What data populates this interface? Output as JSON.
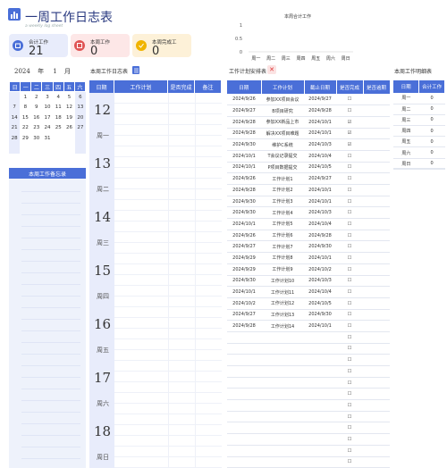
{
  "header": {
    "title": "一周工作日志表",
    "subtitle": "a weekly log sheet"
  },
  "cards": [
    {
      "label": "合计工作",
      "value": "21",
      "color": "#e8ecfb",
      "icon_color": "#4a6fd8"
    },
    {
      "label": "本周工作",
      "value": "0",
      "color": "#fde7e7",
      "icon_color": "#e05555"
    },
    {
      "label": "本周完成工",
      "value": "0",
      "color": "#fdf1d8",
      "icon_color": "#f0b400"
    }
  ],
  "chart_data": {
    "type": "bar",
    "title": "本周合计工作",
    "categories": [
      "周一",
      "周二",
      "周三",
      "周四",
      "周五",
      "周六",
      "周日"
    ],
    "values": [
      0,
      0,
      0,
      0,
      0,
      0,
      0
    ],
    "yticks": [
      "1",
      "0.5",
      "0"
    ],
    "ylim": [
      0,
      1
    ]
  },
  "calendar": {
    "year": "2024",
    "year_suffix": "年",
    "month": "1",
    "month_suffix": "月",
    "weekdays": [
      "日",
      "一",
      "二",
      "三",
      "四",
      "五",
      "六"
    ],
    "weeks": [
      [
        "",
        "1",
        "2",
        "3",
        "4",
        "5",
        "6"
      ],
      [
        "7",
        "8",
        "9",
        "10",
        "11",
        "12",
        "13"
      ],
      [
        "14",
        "15",
        "16",
        "17",
        "18",
        "19",
        "20"
      ],
      [
        "21",
        "22",
        "23",
        "24",
        "25",
        "26",
        "27"
      ],
      [
        "28",
        "29",
        "30",
        "31",
        "",
        "",
        ""
      ],
      [
        "",
        "",
        "",
        "",
        "",
        "",
        ""
      ]
    ]
  },
  "memo": {
    "title": "本周工作备忘录"
  },
  "daily": {
    "title": "本周工作日志表",
    "headers": [
      "日期",
      "工作计划",
      "是否完成",
      "备注"
    ],
    "days": [
      {
        "num": "12",
        "week": "周一"
      },
      {
        "num": "13",
        "week": "周二"
      },
      {
        "num": "14",
        "week": "周三"
      },
      {
        "num": "15",
        "week": "周四"
      },
      {
        "num": "16",
        "week": "周五"
      },
      {
        "num": "17",
        "week": "周六"
      },
      {
        "num": "18",
        "week": "周日"
      }
    ]
  },
  "schedule": {
    "title": "工作计划安排表",
    "headers": [
      "日期",
      "工作计划",
      "截止日期",
      "是否完成",
      "是否逾期"
    ],
    "rows": [
      [
        "2024/9/26",
        "参加XX项目会议",
        "2024/9/27",
        "☐",
        ""
      ],
      [
        "2024/9/27",
        "B项目研究",
        "2024/9/28",
        "☐",
        ""
      ],
      [
        "2024/9/28",
        "参加XX新品上市",
        "2024/10/1",
        "☑",
        ""
      ],
      [
        "2024/9/28",
        "解决XX项目难题",
        "2024/10/1",
        "☑",
        ""
      ],
      [
        "2024/9/30",
        "维护C系统",
        "2024/10/3",
        "☑",
        ""
      ],
      [
        "2024/10/1",
        "T会议记录提交",
        "2024/10/4",
        "☐",
        ""
      ],
      [
        "2024/10/1",
        "P项目数据提交",
        "2024/10/5",
        "☐",
        ""
      ],
      [
        "2024/9/26",
        "工作计划1",
        "2024/9/27",
        "☐",
        ""
      ],
      [
        "2024/9/28",
        "工作计划2",
        "2024/10/1",
        "☐",
        ""
      ],
      [
        "2024/9/30",
        "工作计划3",
        "2024/10/1",
        "☐",
        ""
      ],
      [
        "2024/9/30",
        "工作计划4",
        "2024/10/3",
        "☐",
        ""
      ],
      [
        "2024/10/1",
        "工作计划5",
        "2024/10/4",
        "☐",
        ""
      ],
      [
        "2024/9/26",
        "工作计划6",
        "2024/9/28",
        "☐",
        ""
      ],
      [
        "2024/9/27",
        "工作计划7",
        "2024/9/30",
        "☐",
        ""
      ],
      [
        "2024/9/29",
        "工作计划8",
        "2024/10/1",
        "☐",
        ""
      ],
      [
        "2024/9/29",
        "工作计划9",
        "2024/10/2",
        "☐",
        ""
      ],
      [
        "2024/9/30",
        "工作计划10",
        "2024/10/3",
        "☐",
        ""
      ],
      [
        "2024/10/1",
        "工作计划11",
        "2024/10/4",
        "☐",
        ""
      ],
      [
        "2024/10/2",
        "工作计划12",
        "2024/10/5",
        "☐",
        ""
      ],
      [
        "2024/9/27",
        "工作计划13",
        "2024/9/30",
        "☐",
        ""
      ],
      [
        "2024/9/28",
        "工作计划14",
        "2024/10/1",
        "☐",
        ""
      ],
      [
        "",
        "",
        "",
        "☐",
        ""
      ],
      [
        "",
        "",
        "",
        "☐",
        ""
      ],
      [
        "",
        "",
        "",
        "☐",
        ""
      ],
      [
        "",
        "",
        "",
        "☐",
        ""
      ],
      [
        "",
        "",
        "",
        "☐",
        ""
      ],
      [
        "",
        "",
        "",
        "☐",
        ""
      ],
      [
        "",
        "",
        "",
        "☐",
        ""
      ],
      [
        "",
        "",
        "",
        "☐",
        ""
      ],
      [
        "",
        "",
        "",
        "☐",
        ""
      ],
      [
        "",
        "",
        "",
        "☐",
        ""
      ],
      [
        "",
        "",
        "",
        "☐",
        ""
      ],
      [
        "",
        "",
        "",
        "☐",
        ""
      ]
    ]
  },
  "stats": {
    "title": "本周工作明细表",
    "headers": [
      "日期",
      "合计工作"
    ],
    "rows": [
      [
        "周一",
        "0"
      ],
      [
        "周二",
        "0"
      ],
      [
        "周三",
        "0"
      ],
      [
        "周四",
        "0"
      ],
      [
        "周五",
        "0"
      ],
      [
        "周六",
        "0"
      ],
      [
        "周日",
        "0"
      ]
    ]
  }
}
